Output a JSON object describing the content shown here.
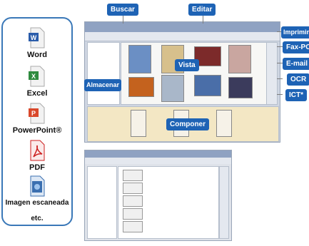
{
  "formats": [
    {
      "label": "Word",
      "icon": "word-file-icon",
      "color": "#2a5caa"
    },
    {
      "label": "Excel",
      "icon": "excel-file-icon",
      "color": "#2e8a3e"
    },
    {
      "label": "PowerPoint®",
      "icon": "powerpoint-file-icon",
      "color": "#d9482b"
    },
    {
      "label": "PDF",
      "icon": "pdf-file-icon",
      "color": "#cc2020"
    },
    {
      "label": "Imagen escaneada",
      "icon": "scanned-image-icon",
      "color": "#3b6fb0"
    },
    {
      "label": "etc.",
      "icon": "",
      "color": ""
    }
  ],
  "callouts": {
    "buscar": "Buscar",
    "editar": "Editar",
    "imprimir": "Imprimir",
    "fax": "Fax-PC",
    "email": "E-mail",
    "ocr": "OCR",
    "ict": "ICT*",
    "vista": "Vista",
    "almacenar": "Almacenar",
    "componer": "Componer"
  },
  "colors": {
    "accent": "#1e63b5",
    "border": "#3a78b8",
    "tray": "#f3e7c4"
  }
}
